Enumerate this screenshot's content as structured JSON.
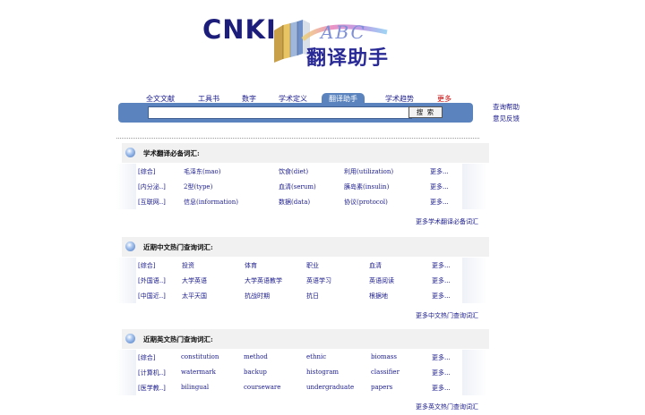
{
  "logo": {
    "brand": "CNKI",
    "abc": "ABC",
    "product": "翻译助手"
  },
  "nav": {
    "tabs": [
      {
        "label": "全文文献"
      },
      {
        "label": "工具书"
      },
      {
        "label": "数字"
      },
      {
        "label": "学术定义"
      },
      {
        "label": "翻译助手",
        "active": true
      },
      {
        "label": "学术趋势"
      },
      {
        "label": "更多"
      }
    ]
  },
  "search": {
    "value": "",
    "placeholder": "",
    "button": "搜 索"
  },
  "side_links": {
    "help": "查询帮助",
    "feedback": "意见反馈"
  },
  "colors": {
    "accent": "#5b84be",
    "link": "#1a1a8c",
    "more": "#cc0000"
  },
  "sections": [
    {
      "title": "学术翻译必备词汇:",
      "rows": [
        {
          "cat": "[综合]",
          "items": [
            "毛泽东(mao)",
            "饮食(diet)",
            "利用(utilization)"
          ],
          "more": "更多..."
        },
        {
          "cat": "[内分泌..]",
          "items": [
            "2型(type)",
            "血清(serum)",
            "胰岛素(insulin)"
          ],
          "more": "更多..."
        },
        {
          "cat": "[互联网..]",
          "items": [
            "信息(information)",
            "数据(data)",
            "协议(protocol)"
          ],
          "more": "更多..."
        }
      ],
      "more_link": "更多学术翻译必备词汇"
    },
    {
      "title": "近期中文热门查询词汇:",
      "rows": [
        {
          "cat": "[综合]",
          "items": [
            "投资",
            "体育",
            "职业",
            "血清"
          ],
          "more": "更多..."
        },
        {
          "cat": "[外国语..]",
          "items": [
            "大学英语",
            "大学英语教学",
            "英语学习",
            "英语阅读"
          ],
          "more": "更多..."
        },
        {
          "cat": "[中国近..]",
          "items": [
            "太平天国",
            "抗战时期",
            "抗日",
            "根据地"
          ],
          "more": "更多..."
        }
      ],
      "more_link": "更多中文热门查询词汇"
    },
    {
      "title": "近期英文热门查询词汇:",
      "rows": [
        {
          "cat": "[综合]",
          "items": [
            "constitution",
            "method",
            "ethnic",
            "biomass"
          ],
          "more": "更多..."
        },
        {
          "cat": "[计算机..]",
          "items": [
            "watermark",
            "backup",
            "histogram",
            "classifier"
          ],
          "more": "更多..."
        },
        {
          "cat": "[医学教..]",
          "items": [
            "bilingual",
            "courseware",
            "undergraduate",
            "papers"
          ],
          "more": "更多..."
        }
      ],
      "more_link": "更多英文热门查询词汇"
    }
  ]
}
